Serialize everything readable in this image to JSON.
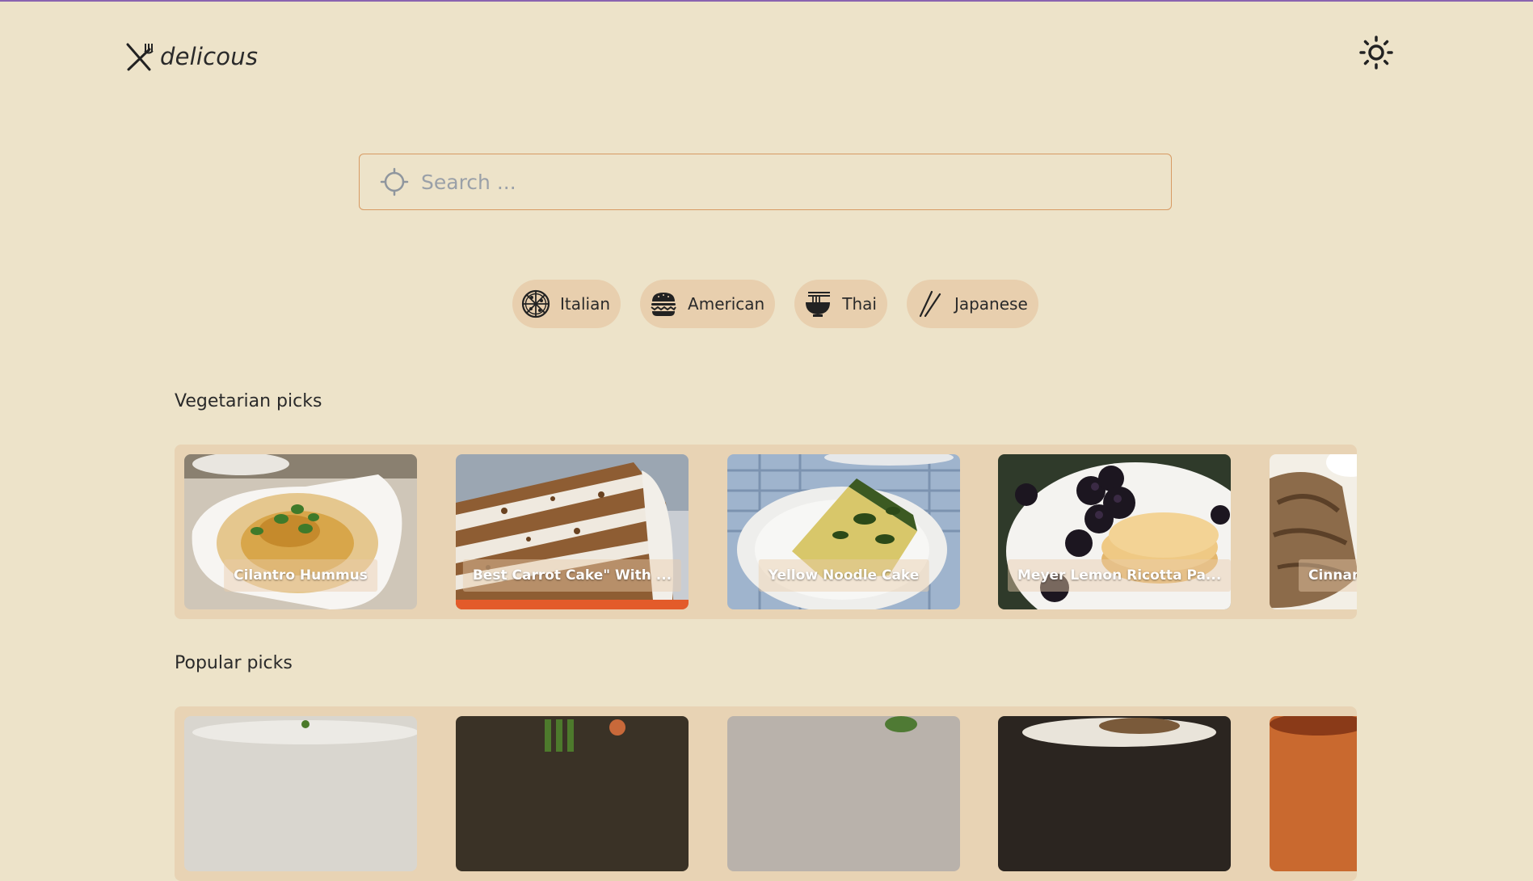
{
  "header": {
    "logo_text": "delicous",
    "logo_icon": "utensils-crossed-icon",
    "theme_icon": "sun-icon"
  },
  "search": {
    "placeholder": "Search ...",
    "value": "",
    "icon": "crosshair-icon"
  },
  "cuisines": [
    {
      "label": "Italian",
      "icon": "pizza-icon"
    },
    {
      "label": "American",
      "icon": "burger-icon"
    },
    {
      "label": "Thai",
      "icon": "noodle-bowl-icon"
    },
    {
      "label": "Japanese",
      "icon": "chopsticks-icon"
    }
  ],
  "sections": {
    "vegetarian": {
      "title": "Vegetarian picks",
      "cards": [
        {
          "title": "Cilantro Hummus"
        },
        {
          "title": "Best Carrot Cake\" With ..."
        },
        {
          "title": "Yellow Noodle Cake"
        },
        {
          "title": "Meyer Lemon Ricotta Pa..."
        },
        {
          "title": "Cinnamo"
        }
      ]
    },
    "popular": {
      "title": "Popular picks"
    }
  },
  "colors": {
    "background": "#ede3c9",
    "chip_background": "#e8cfae",
    "carousel_background": "#e8d3b4",
    "search_border": "#d79a63",
    "top_line": "#8a63b0"
  }
}
